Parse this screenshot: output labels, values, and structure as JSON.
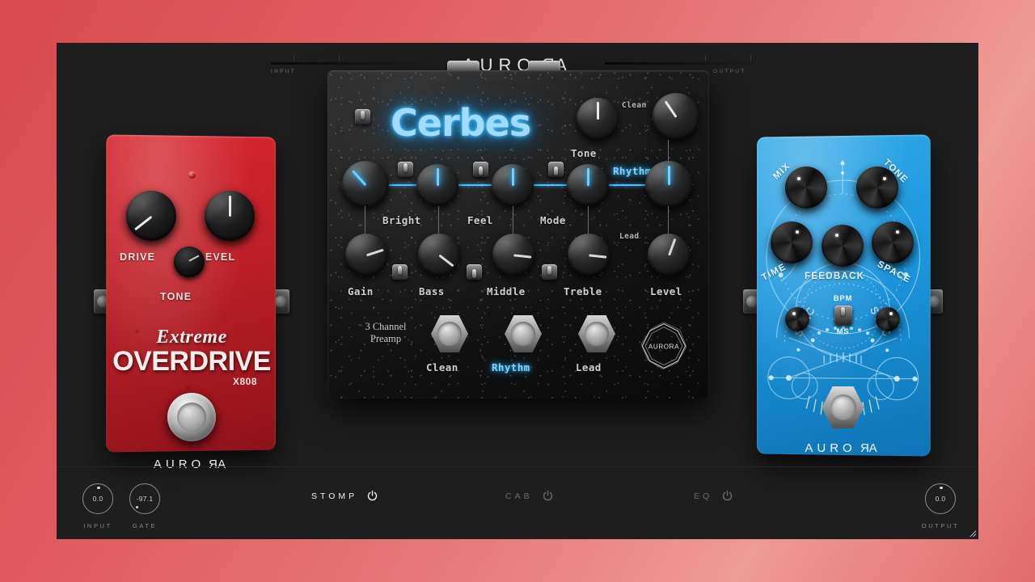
{
  "app": {
    "brand": "AURORA",
    "brand_mirror_letter": "R"
  },
  "header": {
    "input_label": "INPUT",
    "output_label": "OUTPUT"
  },
  "pedals": {
    "overdrive": {
      "name": "Extreme OVERDRIVE",
      "title_line1": "Extreme",
      "title_line2": "OVERDRIVE",
      "model": "X808",
      "brand": "AURORA",
      "color": "#c9242c",
      "knobs": [
        {
          "label": "DRIVE",
          "angle": -128
        },
        {
          "label": "LEVEL",
          "angle": 0
        },
        {
          "label": "TONE",
          "angle": 62
        }
      ]
    },
    "preamp": {
      "name": "Cerbes",
      "subtitle_line1": "3 Channel",
      "subtitle_line2": "Preamp",
      "brand": "AURORA",
      "accent_color": "#4fc3ff",
      "knobs_row_mid": [
        {
          "label": "Gain",
          "angle": -42
        },
        {
          "label": "Bass",
          "angle": 0
        },
        {
          "label": "Middle",
          "angle": 0
        },
        {
          "label": "Treble",
          "angle": 0
        },
        {
          "label": "Level",
          "angle": 0
        }
      ],
      "knobs_row_bottom": [
        {
          "label": "Gain",
          "angle": 72
        },
        {
          "label": "Bass",
          "angle": 128
        },
        {
          "label": "Middle",
          "angle": 96
        },
        {
          "label": "Treble",
          "angle": 96
        },
        {
          "label": "Level",
          "angle": 20
        }
      ],
      "switch_labels": [
        "Bright",
        "Feel",
        "Mode"
      ],
      "channel_labels": [
        "Clean",
        "Rhythm",
        "Lead"
      ],
      "tone_label": "Tone",
      "footswitches": [
        {
          "label": "Clean",
          "active": false
        },
        {
          "label": "Rhythm",
          "active": true
        },
        {
          "label": "Lead",
          "active": false
        }
      ],
      "active_channel": "Rhythm"
    },
    "delay": {
      "brand": "AURORA",
      "color": "#1b96dd",
      "knobs": [
        {
          "label": "MIX",
          "angle": -40
        },
        {
          "label": "TONE",
          "angle": 38
        },
        {
          "label": "TIME",
          "angle": 30
        },
        {
          "label": "FEEDBACK",
          "angle": -28
        },
        {
          "label": "SPACE",
          "angle": 24
        }
      ],
      "small_knobs": [
        {
          "label": "",
          "angle": -30
        },
        {
          "label": "",
          "angle": 30
        }
      ],
      "sync_label": "SYNC",
      "toggle_up_label": "BPM",
      "toggle_down_label": "MS",
      "toggle_position": "up"
    }
  },
  "bottom_bar": {
    "input": {
      "label": "INPUT",
      "value": "0.0",
      "angle": 0
    },
    "gate": {
      "label": "GATE",
      "value": "-97.1",
      "angle": -132
    },
    "output": {
      "label": "OUTPUT",
      "value": "0.0",
      "angle": 0
    },
    "modules": [
      {
        "name": "STOMP",
        "enabled": true
      },
      {
        "name": "CAB",
        "enabled": false
      },
      {
        "name": "EQ",
        "enabled": false
      }
    ]
  }
}
